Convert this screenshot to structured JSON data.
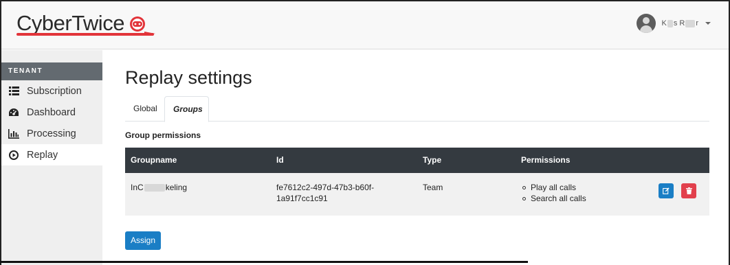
{
  "header": {
    "logo_text": "CyberTwice",
    "user": {
      "name_start": "K",
      "name_mid": "s R",
      "name_end": "r"
    }
  },
  "sidebar": {
    "section": "Tenant",
    "items": [
      {
        "label": "Subscription",
        "icon": "list-icon",
        "active": false
      },
      {
        "label": "Dashboard",
        "icon": "tachometer-icon",
        "active": false
      },
      {
        "label": "Processing",
        "icon": "bar-chart-icon",
        "active": false
      },
      {
        "label": "Replay",
        "icon": "play-circle-icon",
        "active": true
      }
    ]
  },
  "main": {
    "title": "Replay settings",
    "tabs": [
      {
        "label": "Global",
        "active": false
      },
      {
        "label": "Groups",
        "active": true
      }
    ],
    "section_label": "Group permissions",
    "table": {
      "columns": [
        "Groupname",
        "Id",
        "Type",
        "Permissions"
      ],
      "rows": [
        {
          "groupname_start": "InC",
          "groupname_end": "keling",
          "id_line1": "fe7612c2-497d-47b3-b60f-",
          "id_line2": "1a91f7cc1c91",
          "type": "Team",
          "permissions": [
            "Play all calls",
            "Search all calls"
          ]
        }
      ]
    },
    "assign_label": "Assign"
  },
  "colors": {
    "brand_red": "#e2343a",
    "primary_blue": "#1a7ec5",
    "danger_red": "#e2404c",
    "table_header": "#343a40",
    "sidebar_section": "#636a70"
  }
}
